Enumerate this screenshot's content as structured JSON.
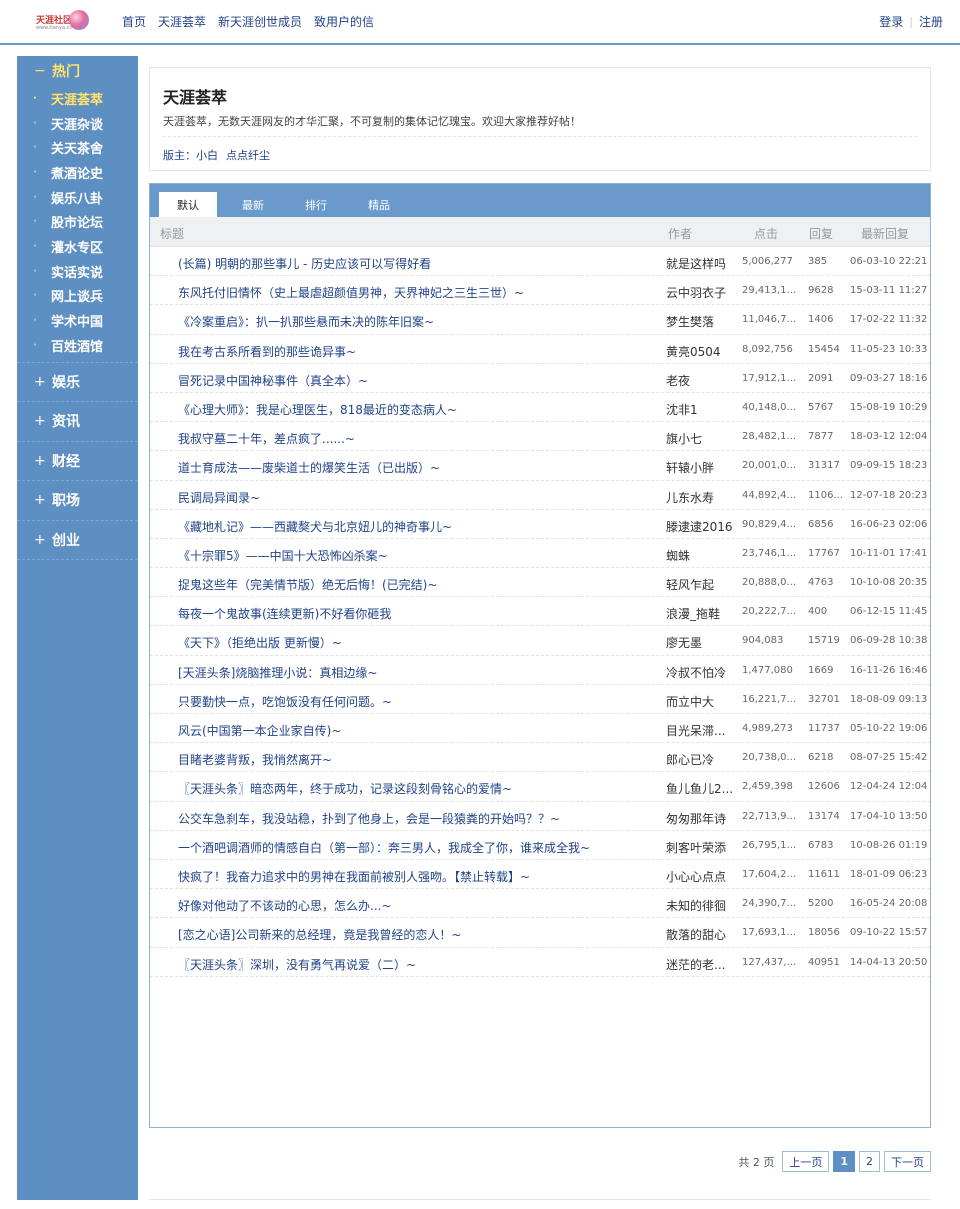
{
  "brand": {
    "logo_text": "天涯社区",
    "logo_sub": "www.tianya.cn"
  },
  "topnav": [
    {
      "label": "首页"
    },
    {
      "label": "天涯荟萃"
    },
    {
      "label": "新天涯创世成员"
    },
    {
      "label": "致用户的信"
    }
  ],
  "auth": {
    "login": "登录",
    "separator": "|",
    "register": "注册"
  },
  "sidebar": {
    "hot_group": {
      "toggle": "−",
      "label": "热门"
    },
    "hot_items": [
      {
        "label": "天涯荟萃",
        "active": true
      },
      {
        "label": "天涯杂谈"
      },
      {
        "label": "关天茶舍"
      },
      {
        "label": "煮酒论史"
      },
      {
        "label": "娱乐八卦"
      },
      {
        "label": "股市论坛"
      },
      {
        "label": "灌水专区"
      },
      {
        "label": "实话实说"
      },
      {
        "label": "网上谈兵"
      },
      {
        "label": "学术中国"
      },
      {
        "label": "百姓酒馆"
      }
    ],
    "item_bullet": "·",
    "groups": [
      {
        "toggle": "+",
        "label": "娱乐"
      },
      {
        "toggle": "+",
        "label": "资讯"
      },
      {
        "toggle": "+",
        "label": "财经"
      },
      {
        "toggle": "+",
        "label": "职场"
      },
      {
        "toggle": "+",
        "label": "创业"
      }
    ]
  },
  "board": {
    "title": "天涯荟萃",
    "description": "天涯荟萃，无数天涯网友的才华汇聚，不可复制的集体记忆瑰宝。欢迎大家推荐好帖！",
    "moderators_label": "版主：",
    "moderators": [
      "小白",
      "点点纤尘"
    ]
  },
  "tabs": [
    {
      "label": "默认",
      "active": true
    },
    {
      "label": "最新"
    },
    {
      "label": "排行"
    },
    {
      "label": "精品"
    }
  ],
  "columns": {
    "title": "标题",
    "author": "作者",
    "clicks": "点击",
    "replies": "回复",
    "last_reply": "最新回复"
  },
  "posts": [
    {
      "title": "(长篇) 明朝的那些事儿 - 历史应该可以写得好看",
      "author": "就是这样吗",
      "clicks": "5,006,277",
      "replies": "385",
      "last": "06-03-10 22:21"
    },
    {
      "title": "东风托付旧情怀（史上最虐超颜值男神，天界神妃之三生三世）~",
      "author": "云中羽衣子",
      "clicks": "29,413,1...",
      "replies": "9628",
      "last": "15-03-11 11:27"
    },
    {
      "title": "《冷案重启》：扒一扒那些悬而未决的陈年旧案~",
      "author": "梦生樊落",
      "clicks": "11,046,7...",
      "replies": "1406",
      "last": "17-02-22 11:32"
    },
    {
      "title": "我在考古系所看到的那些诡异事~",
      "author": "黄亮0504",
      "clicks": "8,092,756",
      "replies": "15454",
      "last": "11-05-23 10:33"
    },
    {
      "title": "冒死记录中国神秘事件（真全本）~",
      "author": "老夜",
      "clicks": "17,912,1...",
      "replies": "2091",
      "last": "09-03-27 18:16"
    },
    {
      "title": "《心理大师》：我是心理医生，818最近的变态病人~",
      "author": "沈非1",
      "clicks": "40,148,0...",
      "replies": "5767",
      "last": "15-08-19 10:29"
    },
    {
      "title": "我叔守墓二十年，差点疯了......~",
      "author": "旗小七",
      "clicks": "28,482,1...",
      "replies": "7877",
      "last": "18-03-12 12:04"
    },
    {
      "title": "道士育成法——废柴道士的爆笑生活（已出版）~",
      "author": "轩辕小胖",
      "clicks": "20,001,0...",
      "replies": "31317",
      "last": "09-09-15 18:23"
    },
    {
      "title": "民调局异闻录~",
      "author": "儿东水寿",
      "clicks": "44,892,4...",
      "replies": "1106...",
      "last": "12-07-18 20:23"
    },
    {
      "title": "《藏地札记》——西藏獒犬与北京妞儿的神奇事儿~",
      "author": "滕逮逮2016",
      "clicks": "90,829,4...",
      "replies": "6856",
      "last": "16-06-23 02:06"
    },
    {
      "title": "《十宗罪5》——中国十大恐怖凶杀案~",
      "author": "蜘蛛",
      "clicks": "23,746,1...",
      "replies": "17767",
      "last": "10-11-01 17:41"
    },
    {
      "title": "捉鬼这些年（完美情节版）绝无后悔！(已完结)~",
      "author": "轻风乍起",
      "clicks": "20,888,0...",
      "replies": "4763",
      "last": "10-10-08 20:35"
    },
    {
      "title": "每夜一个鬼故事(连续更新)不好看你砸我",
      "author": "浪漫_拖鞋",
      "clicks": "20,222,7...",
      "replies": "400",
      "last": "06-12-15 11:45"
    },
    {
      "title": "《天下》（拒绝出版 更新慢）~",
      "author": "廖无墨",
      "clicks": "904,083",
      "replies": "15719",
      "last": "06-09-28 10:38"
    },
    {
      "title": "[天涯头条]烧脑推理小说：真相边缘~",
      "author": "冷叔不怕冷",
      "clicks": "1,477,080",
      "replies": "1669",
      "last": "16-11-26 16:46"
    },
    {
      "title": "只要勤快一点，吃饱饭没有任何问题。~",
      "author": "而立中大",
      "clicks": "16,221,7...",
      "replies": "32701",
      "last": "18-08-09 09:13"
    },
    {
      "title": "风云(中国第一本企业家自传)~",
      "author": "目光呆滞...",
      "clicks": "4,989,273",
      "replies": "11737",
      "last": "05-10-22 19:06"
    },
    {
      "title": "目睹老婆背叛，我悄然离开~",
      "author": "郎心已冷",
      "clicks": "20,738,0...",
      "replies": "6218",
      "last": "08-07-25 15:42"
    },
    {
      "title": "〖天涯头条〗暗恋两年，终于成功，记录这段刻骨铭心的爱情~",
      "author": "鱼儿鱼儿2...",
      "clicks": "2,459,398",
      "replies": "12606",
      "last": "12-04-24 12:04"
    },
    {
      "title": "公交车急刹车，我没站稳，扑到了他身上，会是一段猿粪的开始吗？？~",
      "author": "匆匆那年诗",
      "clicks": "22,713,9...",
      "replies": "13174",
      "last": "17-04-10 13:50"
    },
    {
      "title": "一个酒吧调酒师的情感自白（第一部）：奔三男人，我成全了你，谁来成全我~",
      "author": "刺客叶荣添",
      "clicks": "26,795,1...",
      "replies": "6783",
      "last": "10-08-26 01:19"
    },
    {
      "title": "快疯了！我奋力追求中的男神在我面前被别人强吻。【禁止转载】~",
      "author": "小心心点点",
      "clicks": "17,604,2...",
      "replies": "11611",
      "last": "18-01-09 06:23"
    },
    {
      "title": "好像对他动了不该动的心思，怎么办...~",
      "author": "未知的徘徊",
      "clicks": "24,390,7...",
      "replies": "5200",
      "last": "16-05-24 20:08"
    },
    {
      "title": "[恋之心语]公司新来的总经理，竟是我曾经的恋人！~",
      "author": "散落的甜心",
      "clicks": "17,693,1...",
      "replies": "18056",
      "last": "09-10-22 15:57"
    },
    {
      "title": "〖天涯头条〗深圳，没有勇气再说爱（二）~",
      "author": "迷茫的老...",
      "clicks": "127,437,...",
      "replies": "40951",
      "last": "14-04-13 20:50"
    }
  ],
  "pager": {
    "total": "共 2 页",
    "prev": "上一页",
    "pages": [
      "1",
      "2"
    ],
    "current": "1",
    "next": "下一页"
  },
  "colors": {
    "accent": "#5e8fc3",
    "link": "#22448a",
    "highlight": "#ffe36a"
  }
}
